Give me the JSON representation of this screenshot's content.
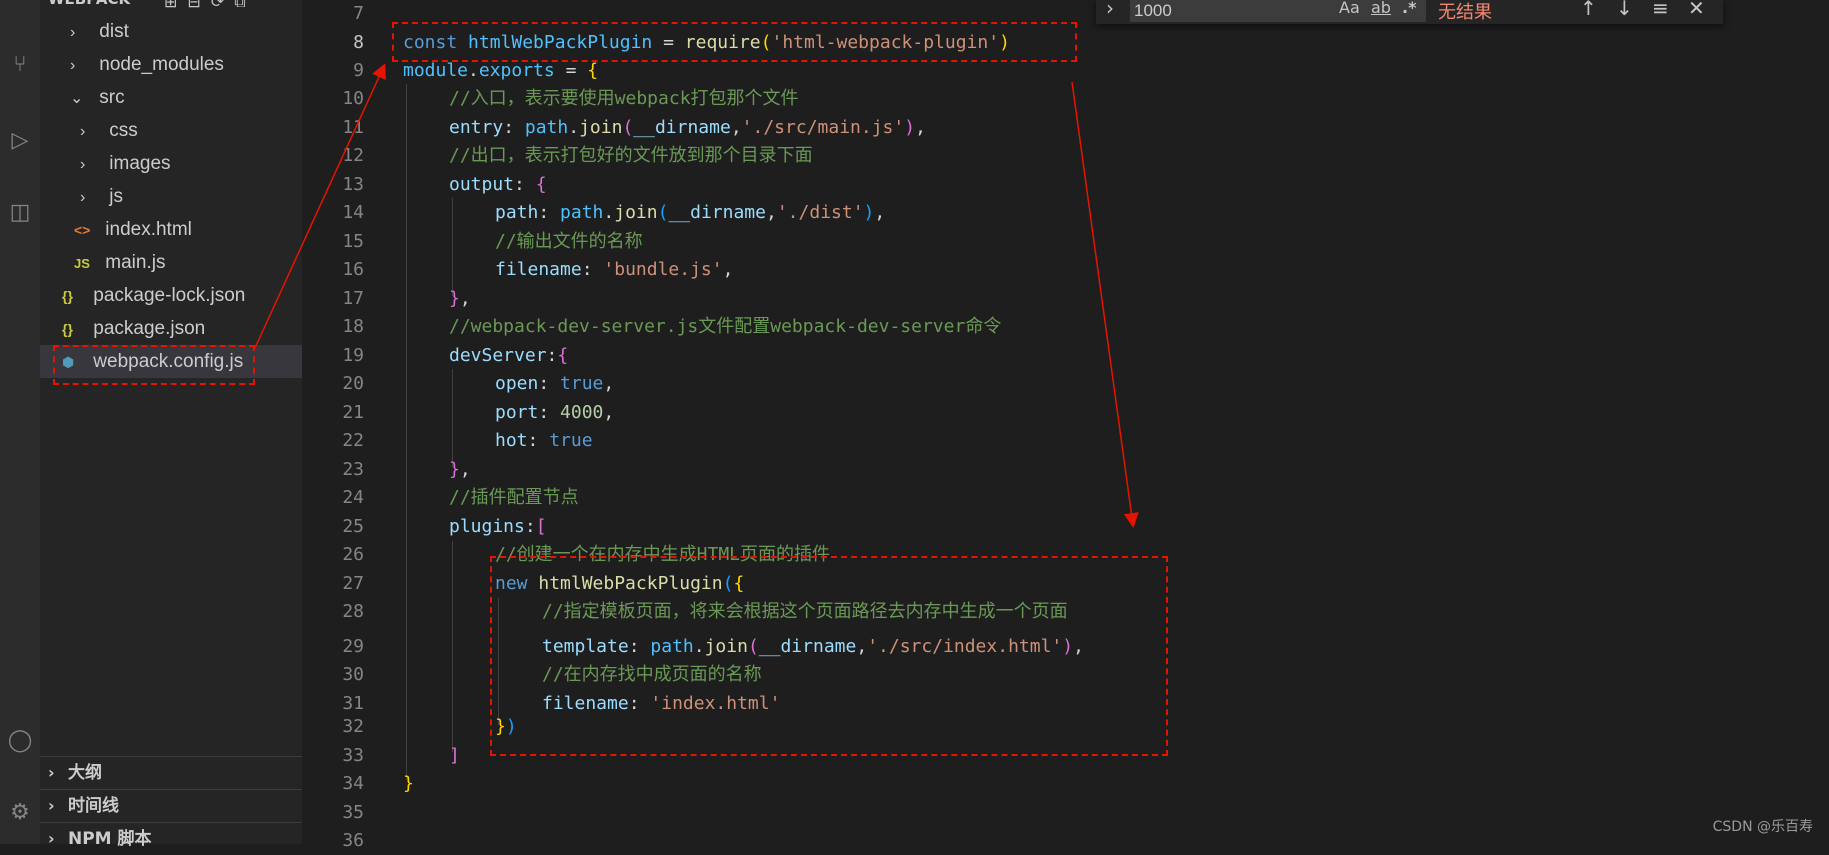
{
  "explorer": {
    "header": "WEBPACK",
    "items": [
      {
        "label": "dist",
        "kind": "folder",
        "expanded": false
      },
      {
        "label": "node_modules",
        "kind": "folder",
        "expanded": false
      },
      {
        "label": "src",
        "kind": "folder",
        "expanded": true
      },
      {
        "label": "css",
        "kind": "folder",
        "expanded": false
      },
      {
        "label": "images",
        "kind": "folder",
        "expanded": false
      },
      {
        "label": "js",
        "kind": "folder",
        "expanded": false
      },
      {
        "label": "index.html",
        "kind": "html"
      },
      {
        "label": "main.js",
        "kind": "js"
      },
      {
        "label": "package-lock.json",
        "kind": "json"
      },
      {
        "label": "package.json",
        "kind": "json"
      },
      {
        "label": "webpack.config.js",
        "kind": "config",
        "selected": true
      }
    ],
    "sections": [
      "大纲",
      "时间线",
      "NPM 脚本"
    ]
  },
  "icons": {
    "chevron_right": "›",
    "chevron_down": "⌄",
    "html": "<>",
    "js": "JS",
    "json": "{}",
    "config": "⬢"
  },
  "find": {
    "value": "1000",
    "match_case": "Aa",
    "whole_word": "ab",
    "regex": ".*",
    "result": "无结果"
  },
  "editor": {
    "lines": [
      {
        "n": "7"
      },
      {
        "n": "8"
      },
      {
        "n": "9"
      },
      {
        "n": "10"
      },
      {
        "n": "11"
      },
      {
        "n": "12"
      },
      {
        "n": "13"
      },
      {
        "n": "14"
      },
      {
        "n": "15"
      },
      {
        "n": "16"
      },
      {
        "n": "17"
      },
      {
        "n": "18"
      },
      {
        "n": "19"
      },
      {
        "n": "20"
      },
      {
        "n": "21"
      },
      {
        "n": "22"
      },
      {
        "n": "23"
      },
      {
        "n": "24"
      },
      {
        "n": "25"
      },
      {
        "n": "26"
      },
      {
        "n": "27"
      },
      {
        "n": "28"
      },
      {
        "n": "29"
      },
      {
        "n": "30"
      },
      {
        "n": "31"
      },
      {
        "n": "32"
      },
      {
        "n": "33"
      },
      {
        "n": "34"
      },
      {
        "n": "35"
      },
      {
        "n": "36"
      }
    ],
    "code": {
      "l8_const": "const",
      "l8_name": "htmlWebPackPlugin",
      "l8_eq": " = ",
      "l8_req": "require",
      "l8_str": "'html-webpack-plugin'",
      "l9_module": "module",
      "l9_exports": "exports",
      "l9_rest": " = ",
      "l10": "//入口，表示要使用webpack打包那个文件",
      "l11_key": "entry",
      "l11_path": "path",
      "l11_join": "join",
      "l11_dir": "__dirname",
      "l11_str": "'./src/main.js'",
      "l12": "//出口，表示打包好的文件放到那个目录下面",
      "l13_key": "output",
      "l14_key": "path",
      "l14_path": "path",
      "l14_join": "join",
      "l14_dir": "__dirname",
      "l14_str": "'./dist'",
      "l15": "//输出文件的名称",
      "l16_key": "filename",
      "l16_str": "'bundle.js'",
      "l18": "//webpack-dev-server.js文件配置webpack-dev-server命令",
      "l19_key": "devServer",
      "l20_key": "open",
      "l20_val": "true",
      "l21_key": "port",
      "l21_val": "4000",
      "l22_key": "hot",
      "l22_val": "true",
      "l24": "//插件配置节点",
      "l25_key": "plugins",
      "l26": "//创建一个在内存中生成HTML页面的插件",
      "l27_new": "new",
      "l27_cls": "htmlWebPackPlugin",
      "l28": "//指定模板页面，将来会根据这个页面路径去内存中生成一个页面",
      "l29_key": "template",
      "l29_path": "path",
      "l29_join": "join",
      "l29_dir": "__dirname",
      "l29_str": "'./src/index.html'",
      "l30": "//在内存找中成页面的名称",
      "l31_key": "filename",
      "l31_str": "'index.html'"
    }
  },
  "watermark": "CSDN @乐百寿",
  "colors": {
    "annotation": "#e51400",
    "accent": "#007acc"
  }
}
